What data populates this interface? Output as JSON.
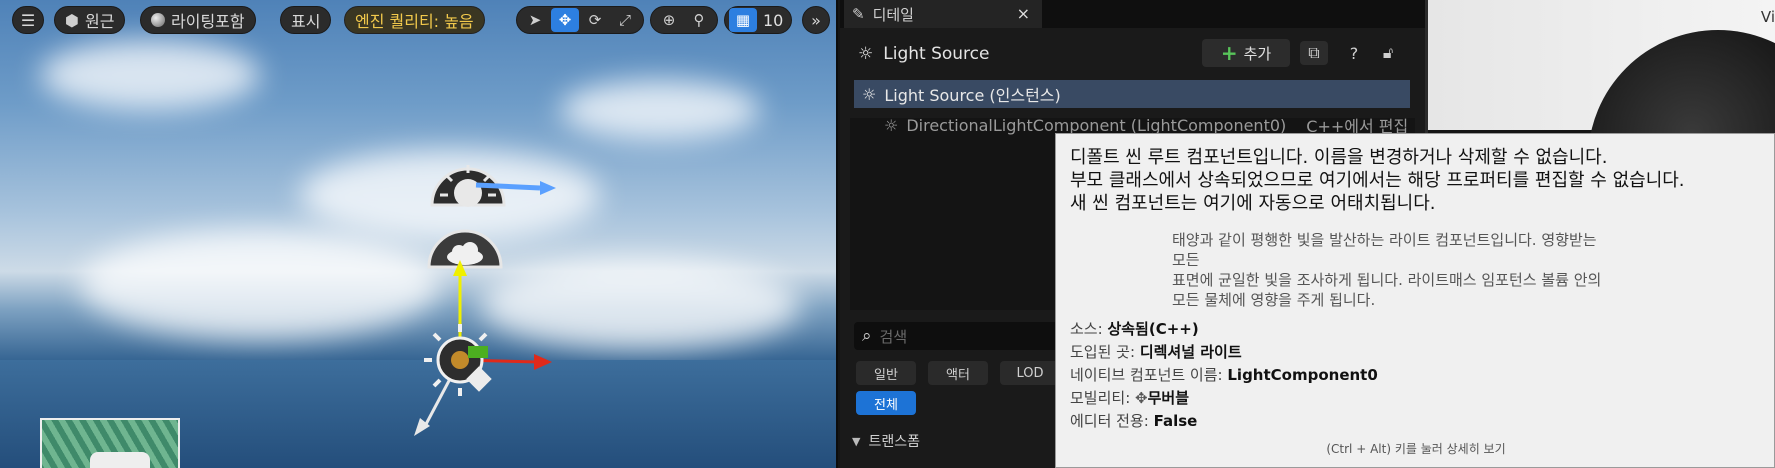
{
  "viewport": {
    "toolbar": {
      "menu_icon": "hamburger-icon",
      "perspective_label": "원근",
      "lighting_label": "라이팅포함",
      "show_label": "표시",
      "quality_label": "엔진 퀄리티: 높음",
      "grid_snap_value": "10"
    }
  },
  "details": {
    "tab_title": "디테일",
    "tab_close": "×",
    "header_title": "Light Source",
    "add_label": "추가",
    "tree": {
      "root_label": "Light Source (인스턴스)",
      "child_label": "DirectionalLightComponent (LightComponent0)",
      "child_action": "C++에서 편집"
    },
    "search_placeholder": "검색",
    "filters": [
      "일반",
      "액터",
      "LOD",
      "전체"
    ],
    "section_label": "트랜스폼"
  },
  "right_image": {
    "text": "Vi"
  },
  "tooltip": {
    "line1": "디폴트 씬 루트 컴포넌트입니다. 이름을 변경하거나 삭제할 수 없습니다.",
    "line2": "부모 클래스에서 상속되었으므로 여기에서는 해당 프로퍼티를 편집할 수 없습니다.",
    "line3": "새 씬 컴포넌트는 여기에 자동으로 어태치됩니다.",
    "desc1": "태양과 같이 평행한 빛을 발산하는 라이트 컴포넌트입니다. 영향받는",
    "desc2": "모든",
    "desc3": "표면에 균일한 빛을 조사하게 됩니다. 라이트매스 임포턴스 볼륨 안의",
    "desc4": "모든 물체에 영향을 주게 됩니다.",
    "props": {
      "source_key": "소스:",
      "source_val": "상속됨(C++)",
      "introduced_key": "도입된 곳:",
      "introduced_val": "디렉셔널 라이트",
      "native_key": "네이티브 컴포넌트 이름:",
      "native_val": "LightComponent0",
      "mobility_key": "모빌리티:",
      "mobility_val": "무버블",
      "editor_key": "에디터 전용:",
      "editor_val": "False"
    },
    "footer": "(Ctrl + Alt) 키를 눌러 상세히 보기"
  }
}
